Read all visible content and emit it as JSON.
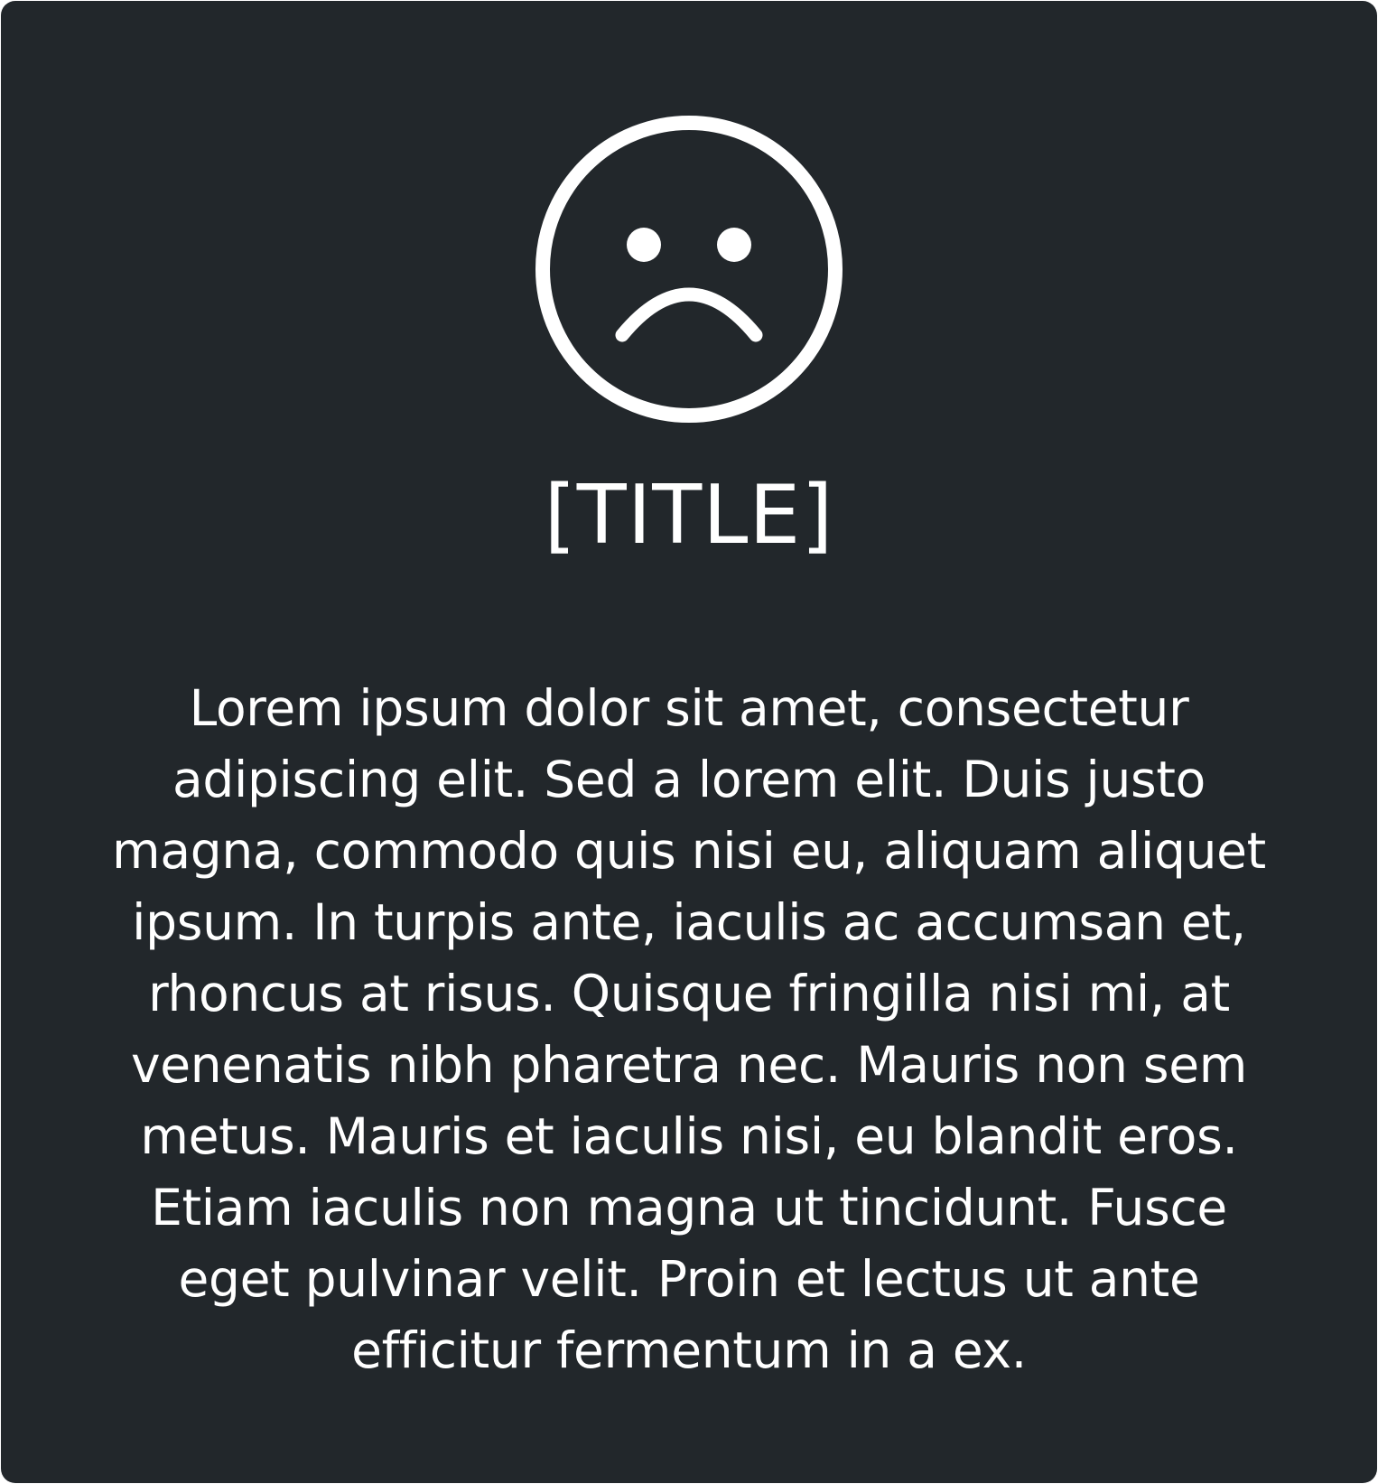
{
  "card": {
    "icon": "sad-face-icon",
    "title": "[TITLE]",
    "body": "Lorem ipsum dolor sit amet, consectetur adipiscing elit. Sed a lorem elit. Duis justo magna, commodo quis nisi eu, aliquam aliquet ipsum. In turpis ante, iaculis ac accumsan et, rhoncus at risus. Quisque fringilla nisi mi, at venenatis nibh pharetra nec. Mauris non sem metus. Mauris et iaculis nisi, eu blandit eros. Etiam iaculis non magna ut tincidunt. Fusce eget pulvinar velit. Proin et lectus ut ante efficitur fermentum in a ex."
  },
  "colors": {
    "background": "#22272b",
    "foreground": "#ffffff"
  }
}
